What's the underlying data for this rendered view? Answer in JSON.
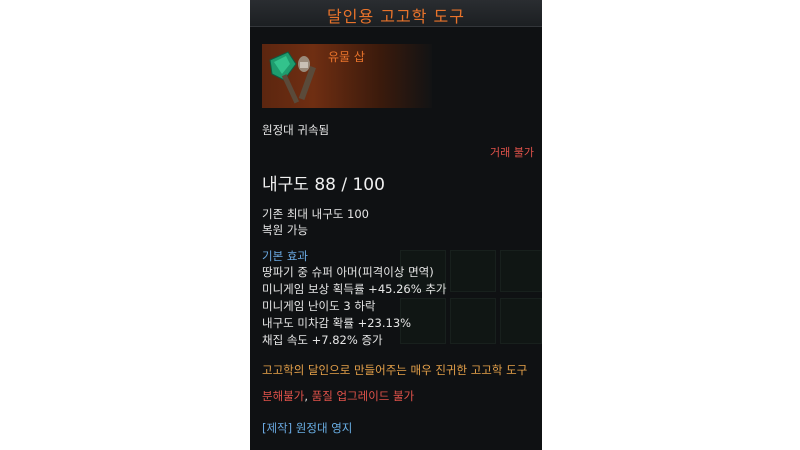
{
  "tooltip": {
    "title": "달인용 고고학 도구",
    "item_type": "유물 삽",
    "binding": "원정대 귀속됨",
    "trade": "거래 불가",
    "durability": "내구도 88 / 100",
    "base_max_durability": "기존 최대 내구도 100",
    "restorable": "복원 가능",
    "effects_header": "기본 효과",
    "effects": [
      "땅파기 중 슈퍼 아머(피격이상 면역)",
      "미니게임 보상 획득률 +45.26% 추가",
      "미니게임 난이도 3 하락",
      "내구도 미차감 확률 +23.13%",
      "채집 속도 +7.82% 증가"
    ],
    "description": "고고학의 달인으로 만들어주는 매우 진귀한 고고학 도구",
    "restriction_a": "분해불가",
    "restriction_sep": ", ",
    "restriction_b": "품질 업그레이드 불가",
    "craft_tag": "[제작]",
    "craft_place": " 원정대 영지"
  },
  "colors": {
    "title": "#e8732b",
    "blue": "#6aa8e0",
    "orange": "#e7a24a",
    "red": "#e0524a"
  },
  "icons": [
    "shovel-icon"
  ]
}
